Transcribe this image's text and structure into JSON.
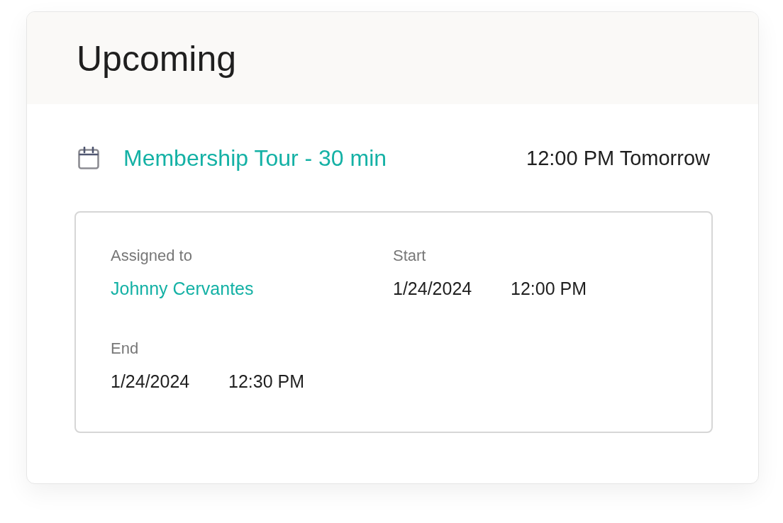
{
  "panel": {
    "title": "Upcoming"
  },
  "events": [
    {
      "title": "Membership Tour - 30 min",
      "when": "12:00 PM Tomorrow",
      "details": [
        {
          "kind": "person",
          "label": "Assigned to",
          "value": "Johnny Cervantes"
        },
        {
          "kind": "datetime",
          "label": "Start",
          "date": "1/24/2024",
          "time": "12:00 PM"
        },
        {
          "kind": "datetime",
          "label": "End",
          "date": "1/24/2024",
          "time": "12:30 PM"
        }
      ]
    }
  ]
}
